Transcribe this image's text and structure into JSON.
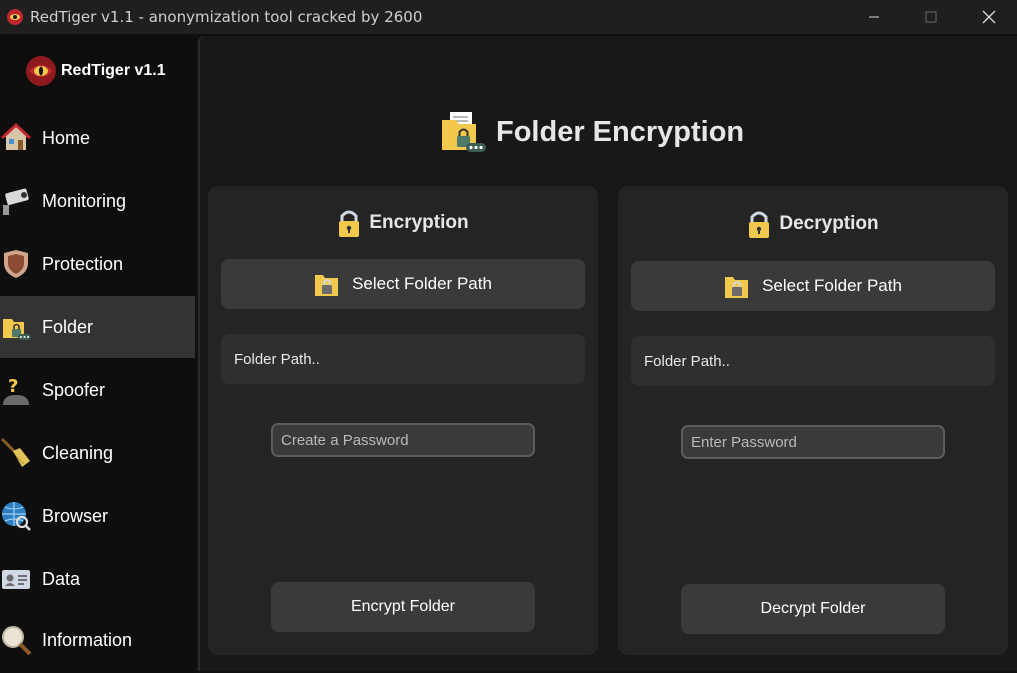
{
  "window": {
    "title": "RedTiger v1.1 - anonymization tool cracked by 2600",
    "min_glyph": "—",
    "max_glyph": "☐",
    "close_glyph": "✕"
  },
  "sidebar": {
    "brand": "RedTiger v1.1",
    "items": [
      {
        "label": "Home",
        "icon": "home-icon"
      },
      {
        "label": "Monitoring",
        "icon": "camera-icon"
      },
      {
        "label": "Protection",
        "icon": "shield-icon"
      },
      {
        "label": "Folder",
        "icon": "folder-lock-icon",
        "active": true
      },
      {
        "label": "Spoofer",
        "icon": "incognito-user-icon"
      },
      {
        "label": "Cleaning",
        "icon": "broom-icon"
      },
      {
        "label": "Browser",
        "icon": "globe-search-icon"
      },
      {
        "label": "Data",
        "icon": "id-card-icon"
      },
      {
        "label": "Information",
        "icon": "magnifier-icon"
      }
    ]
  },
  "page": {
    "title": "Folder Encryption"
  },
  "encryption": {
    "title": "Encryption",
    "select_label": "Select Folder Path",
    "path_text": "Folder Path..",
    "password_placeholder": "Create a Password",
    "action_label": "Encrypt Folder"
  },
  "decryption": {
    "title": "Decryption",
    "select_label": "Select Folder Path",
    "path_text": "Folder Path..",
    "password_placeholder": "Enter Password",
    "action_label": "Decrypt Folder"
  },
  "colors": {
    "background": "#181818",
    "sidebar": "#0e0e0e",
    "panel": "#242424",
    "button": "#3a3a3a",
    "active_nav": "#333333",
    "accent_folder": "#f2c94c",
    "accent_red": "#c0262d"
  }
}
